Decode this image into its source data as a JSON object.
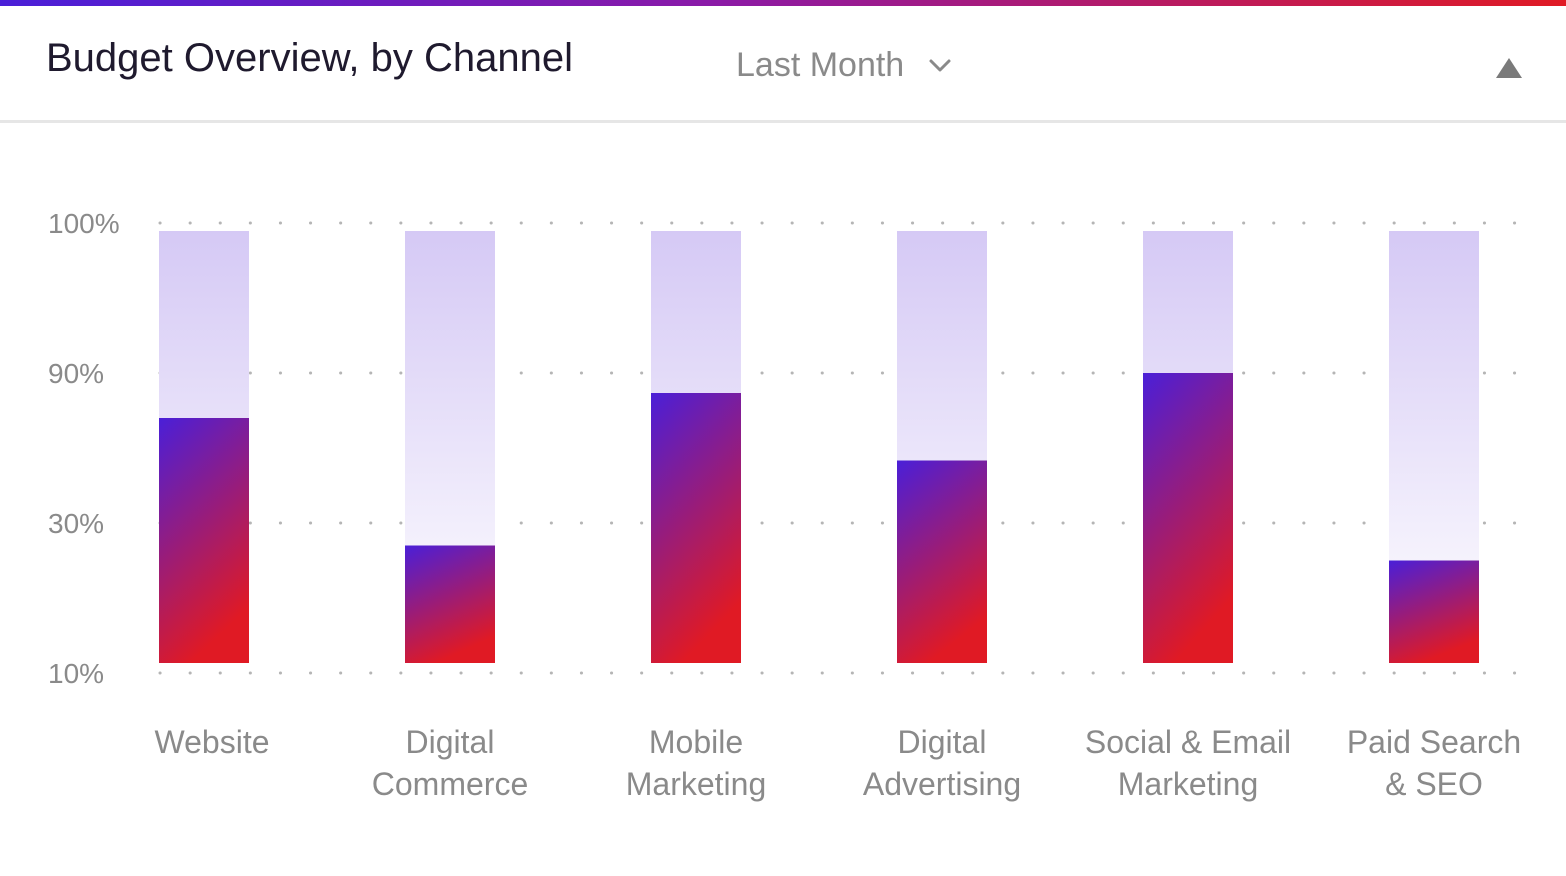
{
  "header": {
    "title": "Budget Overview, by Channel",
    "period_label": "Last Month",
    "period_icon": "chevron-down-icon",
    "collapse_icon": "triangle-up-icon"
  },
  "colors": {
    "accent_start": "#4a1fd8",
    "accent_end": "#e01a24",
    "track_top": "#d5c9f5",
    "track_bottom": "#ffffff",
    "grid": "#b5b5b5",
    "text_muted": "#8a8a8a"
  },
  "chart_data": {
    "type": "bar",
    "title": "Budget Overview, by Channel",
    "yticks": [
      "10%",
      "30%",
      "90%",
      "100%"
    ],
    "categories": [
      [
        "Website"
      ],
      [
        "Digital",
        "Commerce"
      ],
      [
        "Mobile",
        "Marketing"
      ],
      [
        "Digital",
        "Advertising"
      ],
      [
        "Social & Email",
        "Marketing"
      ],
      [
        "Paid Search",
        "& SEO"
      ]
    ],
    "values": [
      72,
      27,
      82,
      55,
      90,
      25
    ],
    "note_scale": "non-linear y-axis: 10% -> 30% -> 90% -> 100% equally spaced",
    "grid": true,
    "legend": "none"
  }
}
